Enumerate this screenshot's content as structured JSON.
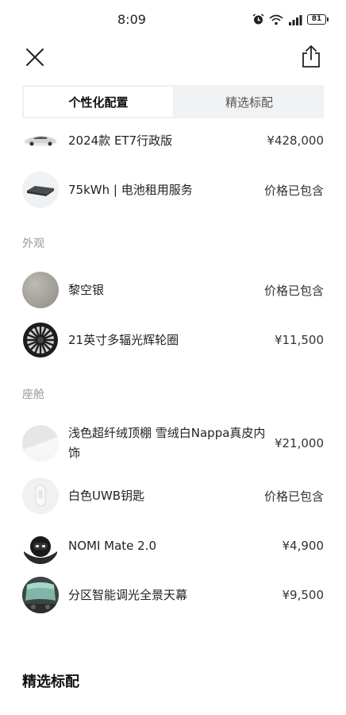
{
  "status_bar": {
    "time": "8:09",
    "battery": "81",
    "icons": [
      "alarm-icon",
      "wifi-icon",
      "signal-icon",
      "battery-icon"
    ]
  },
  "nav": {
    "close_icon": "close-icon",
    "share_icon": "share-icon"
  },
  "tabs": [
    {
      "label": "个性化配置",
      "active": true
    },
    {
      "label": "精选标配",
      "active": false
    }
  ],
  "top_items": [
    {
      "name": "2024款 ET7行政版",
      "price": "¥428,000"
    },
    {
      "name": "75kWh | 电池租用服务",
      "price": "价格已包含"
    }
  ],
  "sections": [
    {
      "title": "外观",
      "items": [
        {
          "name": "黎空银",
          "price": "价格已包含"
        },
        {
          "name": "21英寸多辐光辉轮圈",
          "price": "¥11,500"
        }
      ]
    },
    {
      "title": "座舱",
      "items": [
        {
          "name": "浅色超纤绒顶棚 雪绒白Nappa真皮内饰",
          "price": "¥21,000"
        },
        {
          "name": "白色UWB钥匙",
          "price": "价格已包含"
        },
        {
          "name": "NOMI Mate 2.0",
          "price": "¥4,900"
        },
        {
          "name": "分区智能调光全景天幕",
          "price": "¥9,500"
        }
      ]
    }
  ],
  "featured_title": "精选标配"
}
